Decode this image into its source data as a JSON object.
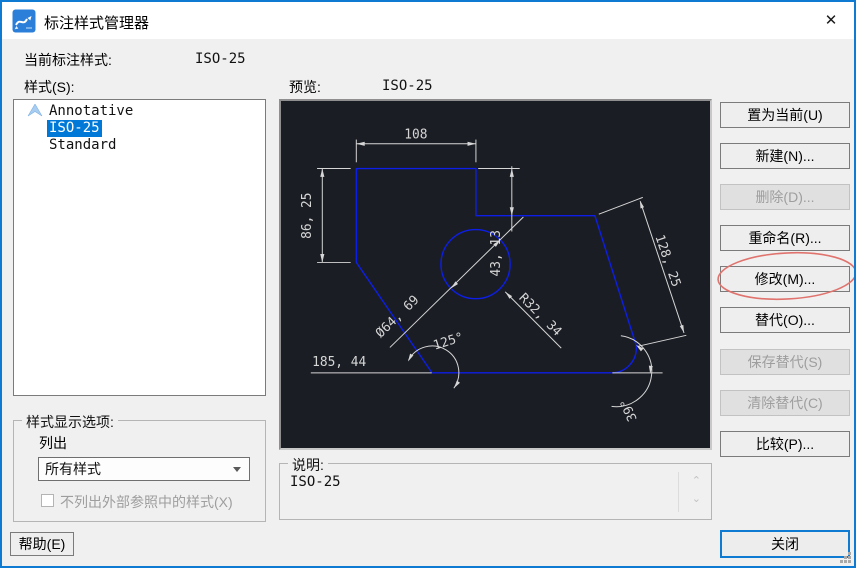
{
  "window": {
    "title": "标注样式管理器",
    "close_icon": "✕"
  },
  "colors": {
    "window_border_blue": "#0f7ad1",
    "selection_blue": "#0078d7",
    "cad_line_blue": "#0d1ee6",
    "preview_background": "#1a1d24",
    "dimension_white": "#d6d6d6",
    "annotation_red": "#e0736d"
  },
  "header": {
    "current_style_label": "当前标注样式:",
    "current_style_value": "ISO-25"
  },
  "styles_panel": {
    "label": "样式(S):",
    "items": [
      {
        "label": "Annotative"
      },
      {
        "label": "ISO-25"
      },
      {
        "label": "Standard"
      }
    ],
    "selected": "ISO-25"
  },
  "preview": {
    "label": "预览:",
    "style_name": "ISO-25",
    "dimensions": {
      "top_width": "108",
      "left_height": "86, 25",
      "notch_height": "43, 13",
      "diameter": "Ø64, 69",
      "radius": "R32, 34",
      "slant_length": "128, 25",
      "bottom_offset": "185, 44",
      "angle_left": "125°",
      "angle_right": "39°"
    }
  },
  "display_options": {
    "group_label": "样式显示选项:",
    "list_label": "列出",
    "list_value": "所有样式",
    "xref_checkbox_label": "不列出外部参照中的样式(X)",
    "xref_checkbox_checked": false
  },
  "description": {
    "group_label": "说明:",
    "text": "ISO-25"
  },
  "actions": {
    "set_current": "置为当前(U)",
    "new": "新建(N)...",
    "delete": "删除(D)...",
    "rename": "重命名(R)...",
    "modify": "修改(M)...",
    "override": "替代(O)...",
    "save_override": "保存替代(S)",
    "clear_override": "清除替代(C)",
    "compare": "比较(P)...",
    "help": "帮助(E)",
    "close": "关闭"
  }
}
